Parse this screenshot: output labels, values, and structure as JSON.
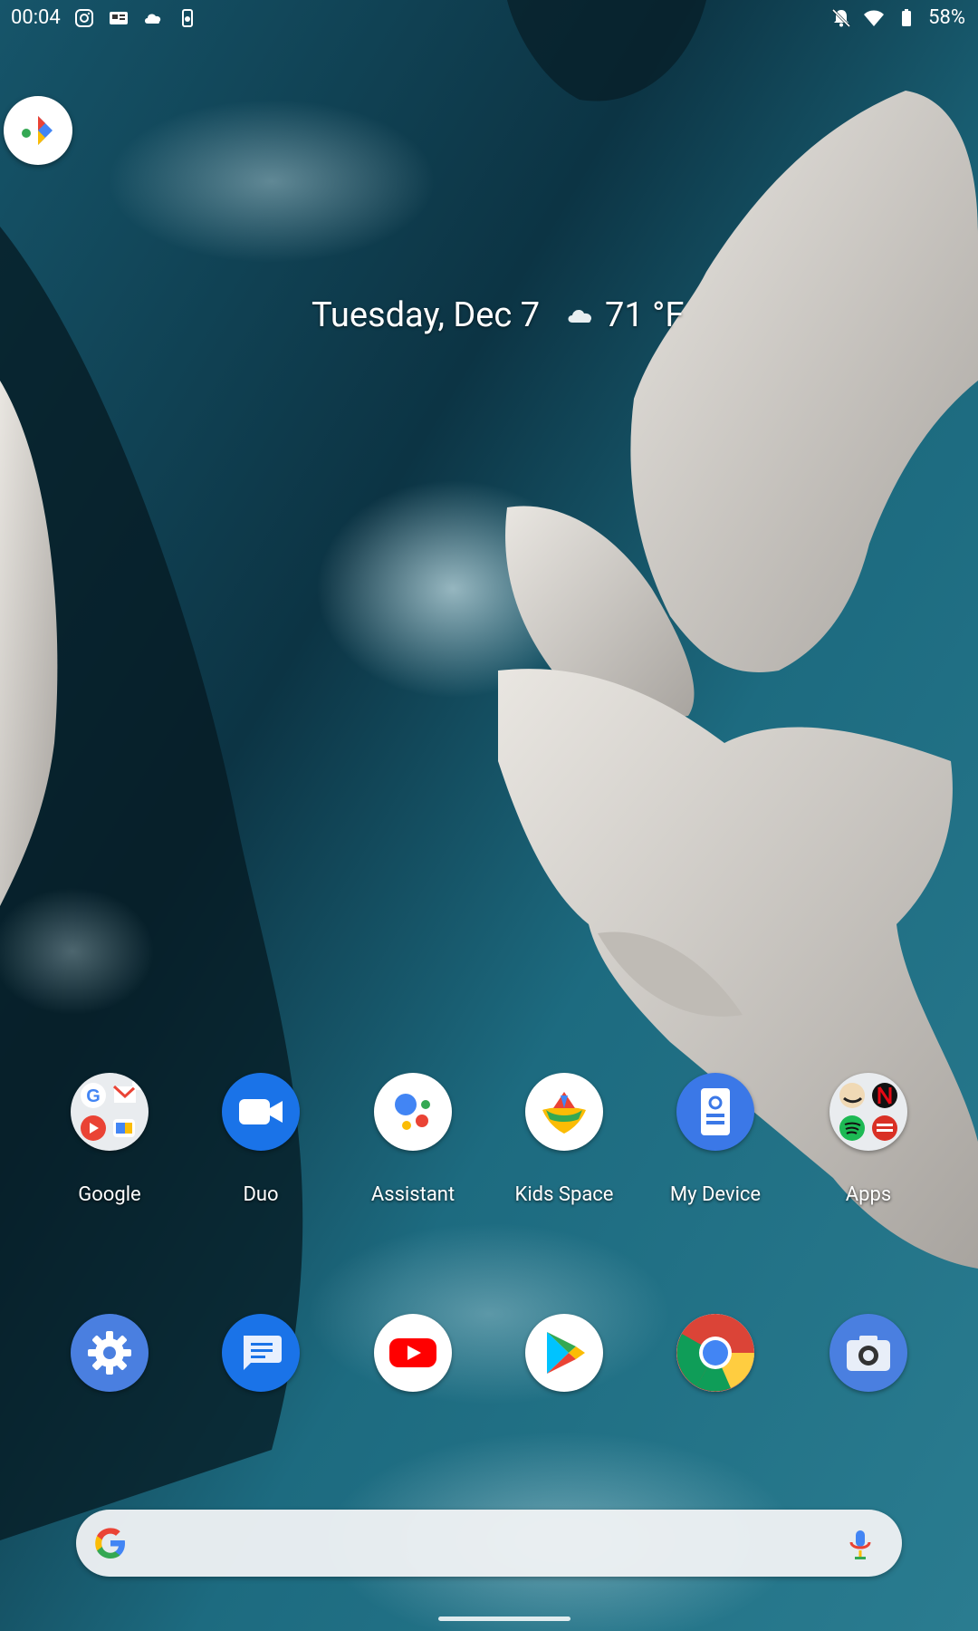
{
  "status_bar": {
    "time": "00:04",
    "battery": "58%",
    "left_icons": [
      "instagram-icon",
      "news-icon",
      "cloud-icon",
      "gauge-icon"
    ],
    "right_icons": [
      "notifications-off-icon",
      "wifi-icon",
      "battery-icon"
    ]
  },
  "at_a_glance": {
    "date": "Tuesday, Dec 7",
    "temperature": "71 °F",
    "weather_icon": "cloudy-icon"
  },
  "floating_app": {
    "icon": "google-assistant-shortcut-icon"
  },
  "home_row_1": [
    {
      "label": "Google",
      "icon": "google-folder-icon"
    },
    {
      "label": "Duo",
      "icon": "duo-icon"
    },
    {
      "label": "Assistant",
      "icon": "assistant-icon"
    },
    {
      "label": "Kids Space",
      "icon": "kids-space-icon"
    },
    {
      "label": "My Device",
      "icon": "my-device-icon"
    },
    {
      "label": "Apps",
      "icon": "apps-folder-icon"
    }
  ],
  "dock": [
    {
      "icon": "settings-icon"
    },
    {
      "icon": "messages-icon"
    },
    {
      "icon": "youtube-icon"
    },
    {
      "icon": "play-store-icon"
    },
    {
      "icon": "chrome-icon"
    },
    {
      "icon": "camera-icon"
    }
  ],
  "search": {
    "icon": "google-g-icon",
    "mic_icon": "mic-icon"
  },
  "colors": {
    "ocean_dark": "#0b2730",
    "ocean_teal": "#1b6a7d",
    "rock": "#d7d4cf",
    "google_blue": "#4285F4",
    "google_red": "#EA4335",
    "google_yellow": "#FBBC05",
    "google_green": "#34A853"
  }
}
